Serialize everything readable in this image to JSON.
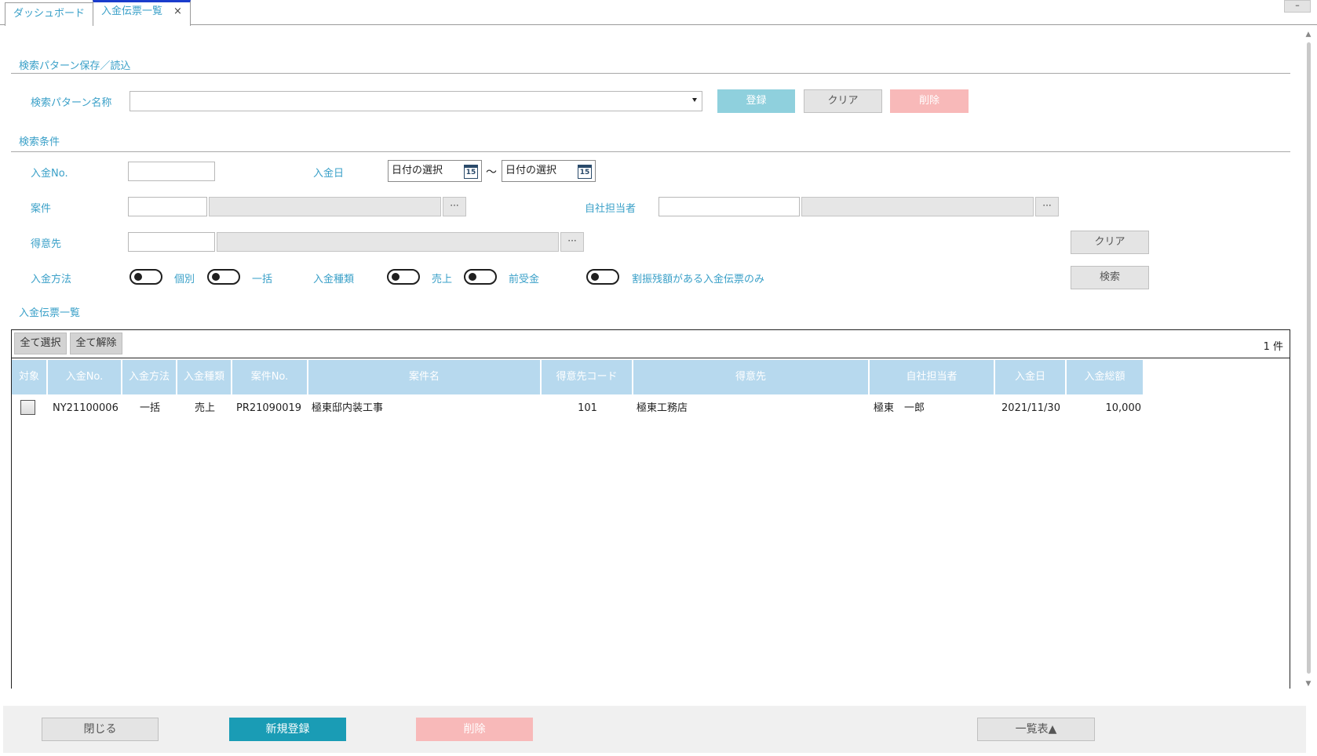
{
  "tabs": [
    {
      "label": "ダッシュボード"
    },
    {
      "label": "入金伝票一覧",
      "close": "×"
    }
  ],
  "window": {
    "minimize": "–"
  },
  "pattern_section": {
    "title": "検索パターン保存／読込",
    "name_label": "検索パターン名称",
    "name_value": "",
    "register": "登録",
    "clear": "クリア",
    "delete": "削除"
  },
  "conditions": {
    "title": "検索条件",
    "payment_no_label": "入金No.",
    "payment_date_label": "入金日",
    "date_from_placeholder": "日付の選択",
    "date_to_placeholder": "日付の選択",
    "date_sep": "～",
    "calendar_day": "15",
    "project_label": "案件",
    "staff_label": "自社担当者",
    "customer_label": "得意先",
    "dots": "···",
    "method_label": "入金方法",
    "method_individual": "個別",
    "method_bulk": "一括",
    "type_label": "入金種類",
    "type_sales": "売上",
    "type_advance": "前受金",
    "balance_only": "割振残額がある入金伝票のみ",
    "clear_button": "クリア",
    "search_button": "検索"
  },
  "list": {
    "title": "入金伝票一覧",
    "select_all": "全て選択",
    "deselect_all": "全て解除",
    "count": "1 件",
    "columns": [
      "対象",
      "入金No.",
      "入金方法",
      "入金種類",
      "案件No.",
      "案件名",
      "得意先コード",
      "得意先",
      "自社担当者",
      "入金日",
      "入金総額"
    ],
    "rows": [
      {
        "checked": false,
        "payment_no": "NY21100006",
        "method": "一括",
        "type": "売上",
        "project_no": "PR21090019",
        "project_name": "極東邸内装工事",
        "customer_code": "101",
        "customer": "極東工務店",
        "staff": "極東　一郎",
        "date": "2021/11/30",
        "total": "10,000"
      }
    ]
  },
  "footer": {
    "close": "閉じる",
    "new": "新規登録",
    "delete": "削除",
    "list_table": "一覧表▲"
  },
  "colors": {
    "label": "#3aa0c8",
    "header": "#b7d9ee",
    "teal": "#1a9cb5",
    "pink": "#f8b9b9",
    "light_blue": "#8fd0dd"
  }
}
